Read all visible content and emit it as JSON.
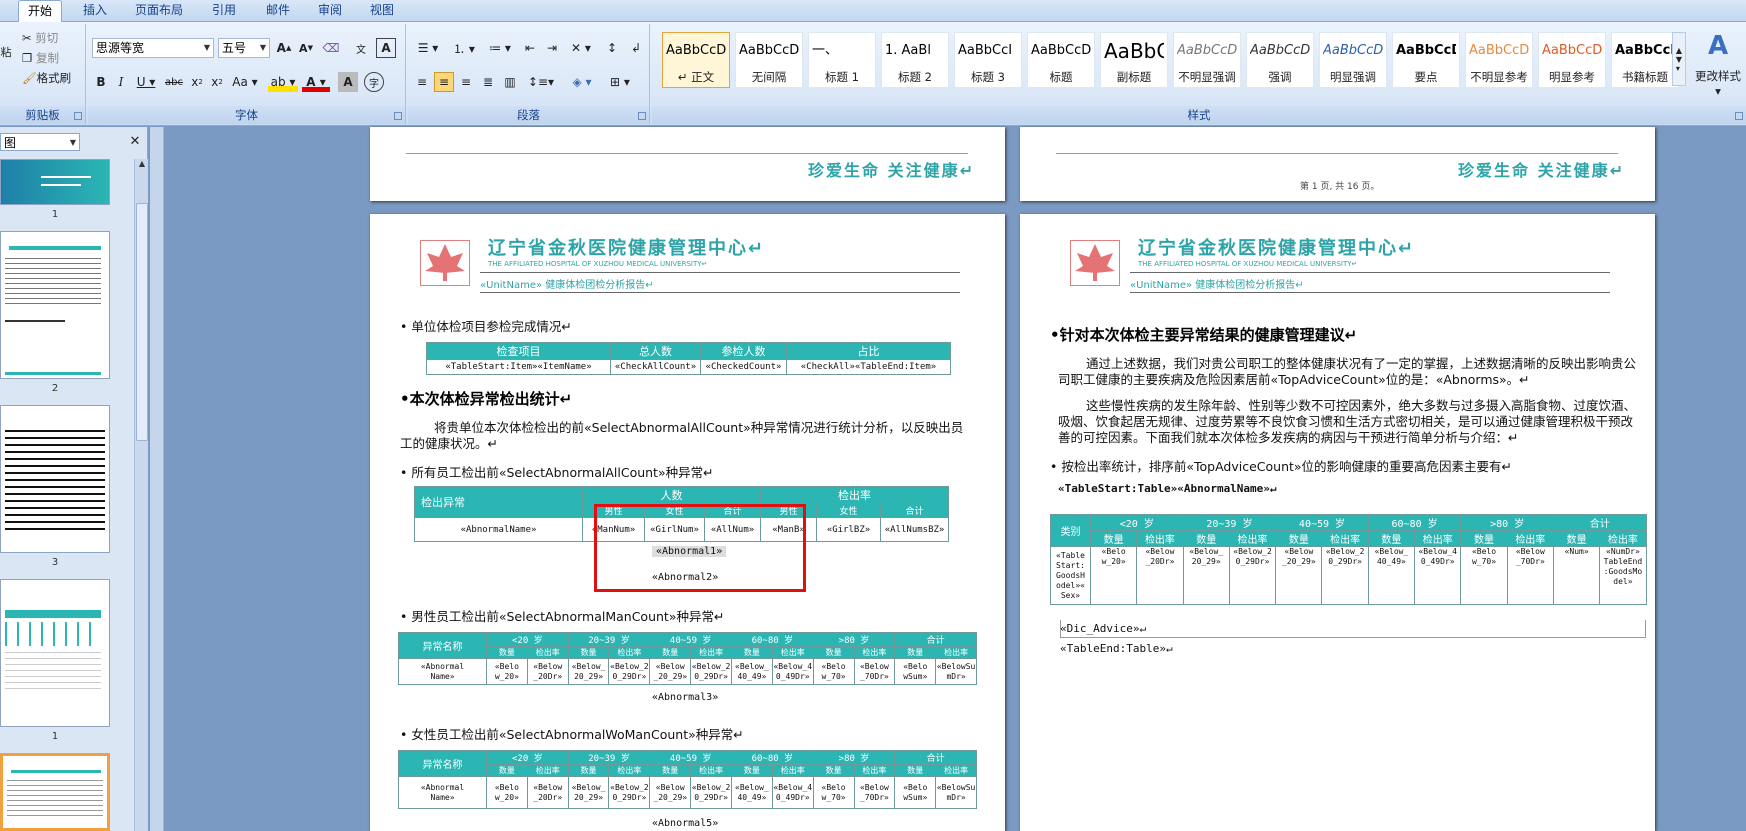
{
  "ribbon_tabs": [
    "开始",
    "插入",
    "页面布局",
    "引用",
    "邮件",
    "审阅",
    "视图"
  ],
  "clipboard": {
    "paste": "粘",
    "cut": "剪切",
    "copy": "复制",
    "format_painter": "格式刷",
    "label": "剪贴板"
  },
  "font": {
    "name": "思源等宽",
    "size": "五号",
    "label": "字体"
  },
  "paragraph": {
    "label": "段落"
  },
  "styles": {
    "label": "样式",
    "change_styles": "更改样式",
    "items": [
      {
        "sample": "AaBbCcDı",
        "name": "↵ 正文"
      },
      {
        "sample": "AaBbCcD",
        "name": "无间隔"
      },
      {
        "sample": "一、",
        "name": "标题 1"
      },
      {
        "sample": "1.  AaBl",
        "name": "标题 2"
      },
      {
        "sample": "AaBbCcI",
        "name": "标题 3"
      },
      {
        "sample": "AaBbCcDdI",
        "name": "标题"
      },
      {
        "sample": "AaBbC",
        "name": "副标题"
      },
      {
        "sample": "AaBbCcD",
        "name": "不明显强调"
      },
      {
        "sample": "AaBbCcD",
        "name": "强调"
      },
      {
        "sample": "AaBbCcD",
        "name": "明显强调"
      },
      {
        "sample": "AaBbCcD",
        "name": "要点"
      },
      {
        "sample": "AaBbCcDı",
        "name": "不明显参考"
      },
      {
        "sample": "AaBbCcDı",
        "name": "明显参考"
      },
      {
        "sample": "AaBbCcDı",
        "name": "书籍标题"
      }
    ]
  },
  "nav": {
    "view": "图",
    "thumb_numbers": [
      "1",
      "2",
      "3",
      "1"
    ]
  },
  "page_header": {
    "slogan": "珍爱生命 关注健康↵",
    "page_count": "第 1 页, 共 16 页。"
  },
  "letterhead": {
    "org": "辽宁省金秋医院健康管理中心↵",
    "org_en": "THE AFFILIATED HOSPITAL OF XUZHOU MEDICAL UNIVERSITY↵",
    "subtitle": "«UnitName» 健康体检团检分析报告↵"
  },
  "left_page": {
    "sec1": "• 单位体检项目参检完成情况↵",
    "t1_head": [
      "检查项目",
      "总人数",
      "参检人数",
      "占比"
    ],
    "t1_row": [
      "«TableStart:Item»«ItemName»",
      "«CheckAllCount»",
      "«CheckedCount»",
      "«CheckAll»«TableEnd:Item»"
    ],
    "sec2": "•本次体检异常检出统计↵",
    "para1": "将贵单位本次体检检出的前«SelectAbnormalAllCount»种异常情况进行统计分析，以反映出员工的健康状况。↵",
    "sec3": "• 所有员工检出前«SelectAbnormalAllCount»种异常↵",
    "t2_h1": [
      "检出异常",
      "人数",
      "检出率"
    ],
    "t2_h2": [
      "男性",
      "女性",
      "合计",
      "男性",
      "女性",
      "合计"
    ],
    "t2_row": [
      "«AbnormalName»",
      "«ManNum»",
      "«GirlNum»",
      "«AllNum»",
      "«ManB»",
      "«GirlBZ»",
      "«AllNumsBZ»"
    ],
    "abn1": "«Abnormal1»",
    "abn2": "«Abnormal2»",
    "sec4": "• 男性员工检出前«SelectAbnormalManCount»种异常↵",
    "abn3": "«Abnormal3»",
    "sec5": "• 女性员工检出前«SelectAbnormalWoManCount»种异常↵",
    "abn5": "«Abnormal5»"
  },
  "age_table": {
    "name_col": "异常名称",
    "groups": [
      "<20 岁",
      "20~39 岁",
      "40~59 岁",
      "60~80 岁",
      ">80 岁",
      "合计"
    ],
    "sub": [
      "数量",
      "检出率"
    ],
    "cells": [
      "«Belo\nw_20»",
      "«Below\n_20Dr»",
      "«Below_\n20_29»",
      "«Below_2\n0_29Dr»",
      "«Below\n_20_29»",
      "«Below_2\n0_29Dr»",
      "«Below_\n40_49»",
      "«Below_4\n0_49Dr»",
      "«Belo\nw_70»",
      "«Below\n_70Dr»",
      "«Belo\nwSum»",
      "«BelowSu\nmDr»"
    ],
    "row_name": "«Abnormal\nName»"
  },
  "right_page": {
    "heading": "•针对本次体检主要异常结果的健康管理建议↵",
    "para1": "通过上述数据，我们对贵公司职工的整体健康状况有了一定的掌握，上述数据清晰的反映出影响贵公司职工健康的主要疾病及危险因素居前«TopAdviceCount»位的是：«Abnorms»。↵",
    "para2": "这些慢性疾病的发生除年龄、性别等少数不可控因素外，绝大多数与过多摄入高脂食物、过度饮酒、吸烟、饮食起居无规律、过度劳累等不良饮食习惯和生活方式密切相关，是可以通过健康管理积极干预改善的可控因素。下面我们就本次体检多发疾病的病因与干预进行简单分析与介绍：↵",
    "sec": "• 按检出率统计，排序前«TopAdviceCount»位的影响健康的重要高危因素主要有↵",
    "tablestart": "«TableStart:Table»«AbnormalName»↵",
    "cat": "类别",
    "first_cell": "«Table\nStart:\nGoodsH\nodel»«\nSex»",
    "sum_cells": [
      "«Num»",
      "«NumDr»\nTableEnd\n:GoodsMo\ndel»"
    ],
    "dic": "«Dic_Advice»↵",
    "tableend": "«TableEnd:Table»↵"
  }
}
